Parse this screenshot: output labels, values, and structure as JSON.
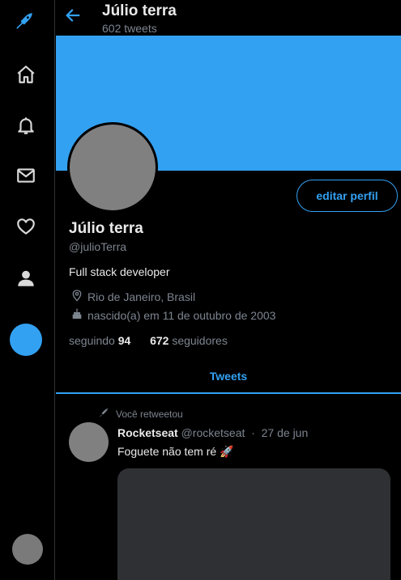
{
  "header": {
    "name": "Júlio terra",
    "tweet_count": "602 tweets"
  },
  "profile": {
    "name": "Júlio terra",
    "handle": "@julioTerra",
    "bio": "Full stack developer",
    "location": "Rio de Janeiro, Brasil",
    "birth": "nascido(a) em 11 de outubro de 2003",
    "following_label": "seguindo",
    "following_count": "94",
    "followers_count": "672",
    "followers_label": "seguidores",
    "edit_button": "editar perfil"
  },
  "tabs": {
    "tweets": "Tweets"
  },
  "tweet": {
    "retweet_label": "Você retweetou",
    "author_name": "Rocketseat",
    "author_handle": "@rocketseat",
    "separator": "·",
    "date": "27 de jun",
    "text": "Foguete não tem ré 🚀"
  },
  "colors": {
    "accent": "#33a1f2",
    "background": "#000000",
    "avatar_placeholder": "#808080",
    "muted_text": "#7d8590"
  },
  "icons": {
    "logo": "rocket-bird-icon",
    "home": "home-icon",
    "notifications": "bell-icon",
    "messages": "mail-icon",
    "likes": "heart-icon",
    "profile": "user-icon",
    "back": "arrow-left-icon",
    "location": "location-pin-icon",
    "birthday": "cake-icon",
    "retweet": "rocket-icon"
  }
}
